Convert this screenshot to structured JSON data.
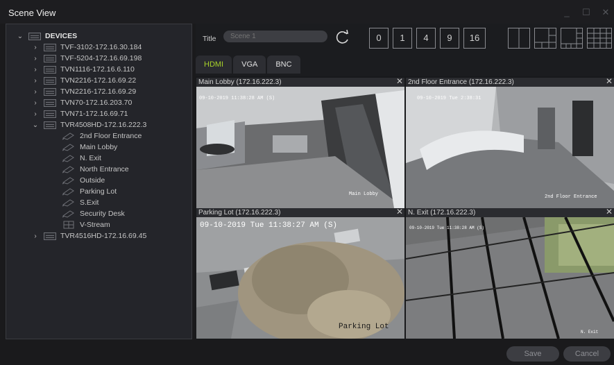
{
  "window": {
    "title": "Scene View"
  },
  "tree": {
    "root_label": "DEVICES",
    "devices": [
      {
        "label": "TVF-3102-172.16.30.184"
      },
      {
        "label": "TVF-5204-172.16.69.198"
      },
      {
        "label": "TVN1116-172.16.6.110"
      },
      {
        "label": "TVN2216-172.16.69.22"
      },
      {
        "label": "TVN2216-172.16.69.29"
      },
      {
        "label": "TVN70-172.16.203.70"
      },
      {
        "label": "TVN71-172.16.69.71"
      },
      {
        "label": "TVR4508HD-172.16.222.3"
      }
    ],
    "cameras": [
      {
        "label": "2nd Floor Entrance"
      },
      {
        "label": "Main Lobby"
      },
      {
        "label": "N. Exit"
      },
      {
        "label": "North Entrance"
      },
      {
        "label": "Outside"
      },
      {
        "label": "Parking Lot"
      },
      {
        "label": "S.Exit"
      },
      {
        "label": "Security Desk"
      },
      {
        "label": "V-Stream"
      }
    ],
    "last_device": {
      "label": "TVR4516HD-172.16.69.45"
    }
  },
  "toolbar": {
    "title_label": "Title",
    "title_placeholder": "Scene 1",
    "layout_buttons": [
      "0",
      "1",
      "4",
      "9",
      "16"
    ]
  },
  "tabs": [
    {
      "label": "HDMI",
      "active": true
    },
    {
      "label": "VGA",
      "active": false
    },
    {
      "label": "BNC",
      "active": false
    }
  ],
  "tiles": [
    {
      "title": "Main Lobby (172.16.222.3)",
      "osd_time": "09-10-2019 11:38:28 AM (S)",
      "osd_name": "Main Lobby"
    },
    {
      "title": "2nd Floor Entrance (172.16.222.3)",
      "osd_time": "09-10-2019 Tue 2:38:31",
      "osd_name": "2nd Floor Entrance"
    },
    {
      "title": "Parking Lot (172.16.222.3)",
      "osd_time": "09-10-2019 Tue 11:38:27 AM (S)",
      "osd_name": "Parking Lot"
    },
    {
      "title": "N. Exit (172.16.222.3)",
      "osd_time": "09-10-2019 Tue 11:38:28 AM (S)",
      "osd_name": "N. Exit"
    }
  ],
  "footer": {
    "save_label": "Save",
    "cancel_label": "Cancel"
  },
  "icons": {
    "expand": "chevron-right-icon",
    "collapse": "chevron-down-icon",
    "device": "recorder-icon",
    "camera": "camera-icon",
    "stream": "grid-icon",
    "refresh": "refresh-icon",
    "close": "close-icon"
  },
  "colors": {
    "accent": "#a7d12a",
    "panel": "#24252a",
    "background": "#1a1a1c"
  }
}
